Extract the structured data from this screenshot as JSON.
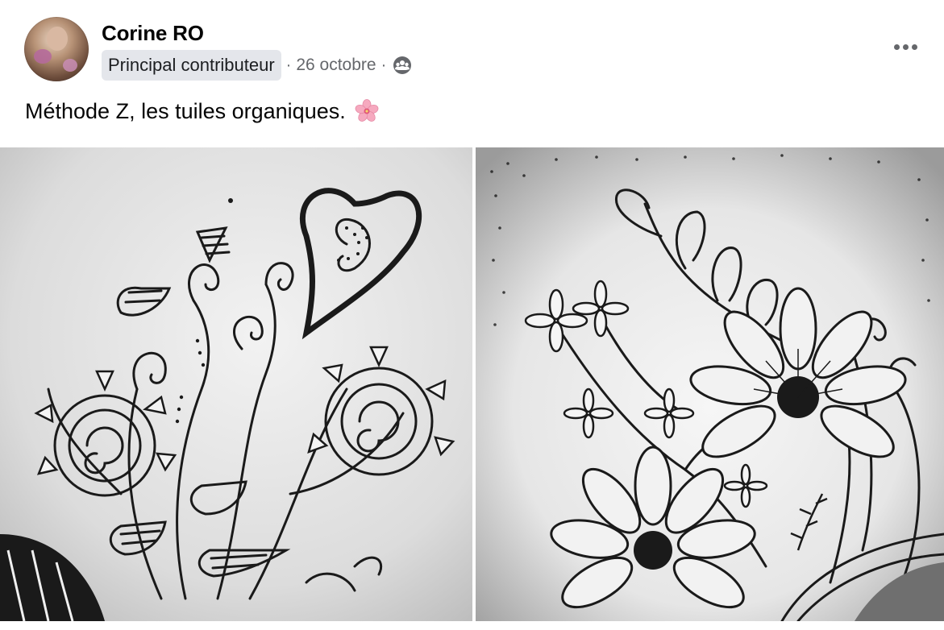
{
  "post": {
    "author": "Corine RO",
    "badge": "Principal contributeur",
    "separator": "·",
    "date": "26 octobre",
    "audience_icon": "group-icon",
    "more_icon": "more-horizontal-icon",
    "caption": "Méthode Z, les tuiles organiques.",
    "caption_emoji": "cherry-blossom-icon"
  },
  "photos": [
    {
      "name": "zentangle-organic-tile-left"
    },
    {
      "name": "zentangle-organic-tile-right"
    }
  ],
  "colors": {
    "badge_bg": "#e4e6eb",
    "secondary_text": "#65676b",
    "primary_text": "#050505"
  }
}
